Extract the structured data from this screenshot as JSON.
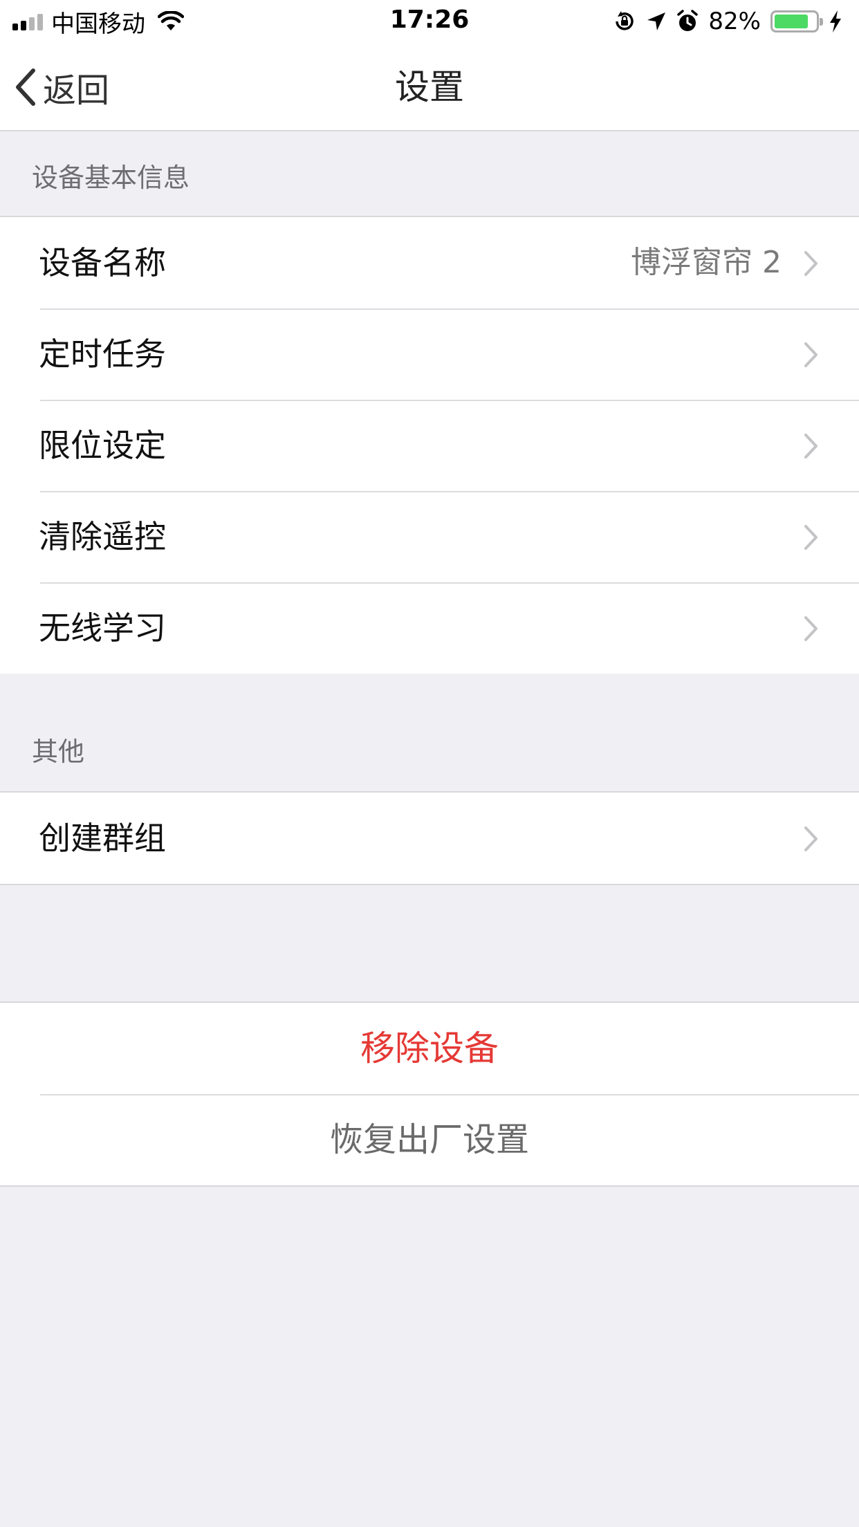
{
  "status_bar": {
    "carrier": "中国移动",
    "time": "17:26",
    "battery_percent": "82%",
    "battery_level": 0.82,
    "icons": [
      "signal-icon",
      "wifi-icon",
      "rotation-lock-icon",
      "location-icon",
      "alarm-icon",
      "battery-icon",
      "charging-icon"
    ]
  },
  "nav": {
    "back_label": "返回",
    "title": "设置"
  },
  "sections": {
    "basic_info": {
      "header": "设备基本信息",
      "rows": [
        {
          "label": "设备名称",
          "value": "博浮窗帘 2"
        },
        {
          "label": "定时任务"
        },
        {
          "label": "限位设定"
        },
        {
          "label": "清除遥控"
        },
        {
          "label": "无线学习"
        }
      ]
    },
    "other": {
      "header": "其他",
      "rows": [
        {
          "label": "创建群组"
        }
      ]
    },
    "actions": {
      "remove_device": "移除设备",
      "factory_reset": "恢复出厂设置"
    }
  },
  "colors": {
    "destructive": "#e53935",
    "secondary_text": "#6d6d72",
    "background": "#efeff4",
    "battery_fill": "#4cd964"
  }
}
